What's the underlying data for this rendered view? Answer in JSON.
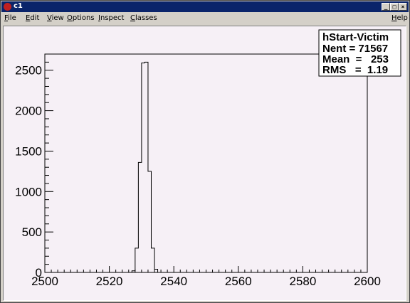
{
  "window": {
    "title": "c1",
    "buttons": {
      "minimize": "_",
      "maximize": "□",
      "close": "×"
    }
  },
  "menubar": {
    "items": [
      "File",
      "Edit",
      "View",
      "Options",
      "Inspect",
      "Classes"
    ],
    "help": "Help"
  },
  "stats": {
    "name": "hStart-Victim",
    "nent": "Nent = 71567",
    "mean": "Mean  =   253",
    "rms": "RMS   =  1.19"
  },
  "chart_data": {
    "type": "histogram",
    "xlim": [
      2500,
      2600
    ],
    "ylim": [
      0,
      2700
    ],
    "bin_width": 1,
    "x_ticks": [
      2500,
      2520,
      2540,
      2560,
      2580,
      2600
    ],
    "y_ticks": [
      0,
      500,
      1000,
      1500,
      2000,
      2500
    ],
    "bins": [
      {
        "x": 2527,
        "value": 20
      },
      {
        "x": 2528,
        "value": 300
      },
      {
        "x": 2529,
        "value": 1360
      },
      {
        "x": 2530,
        "value": 2590
      },
      {
        "x": 2531,
        "value": 2600
      },
      {
        "x": 2532,
        "value": 1250
      },
      {
        "x": 2533,
        "value": 300
      },
      {
        "x": 2534,
        "value": 40
      }
    ],
    "line_color": "#000000",
    "grid": false
  }
}
